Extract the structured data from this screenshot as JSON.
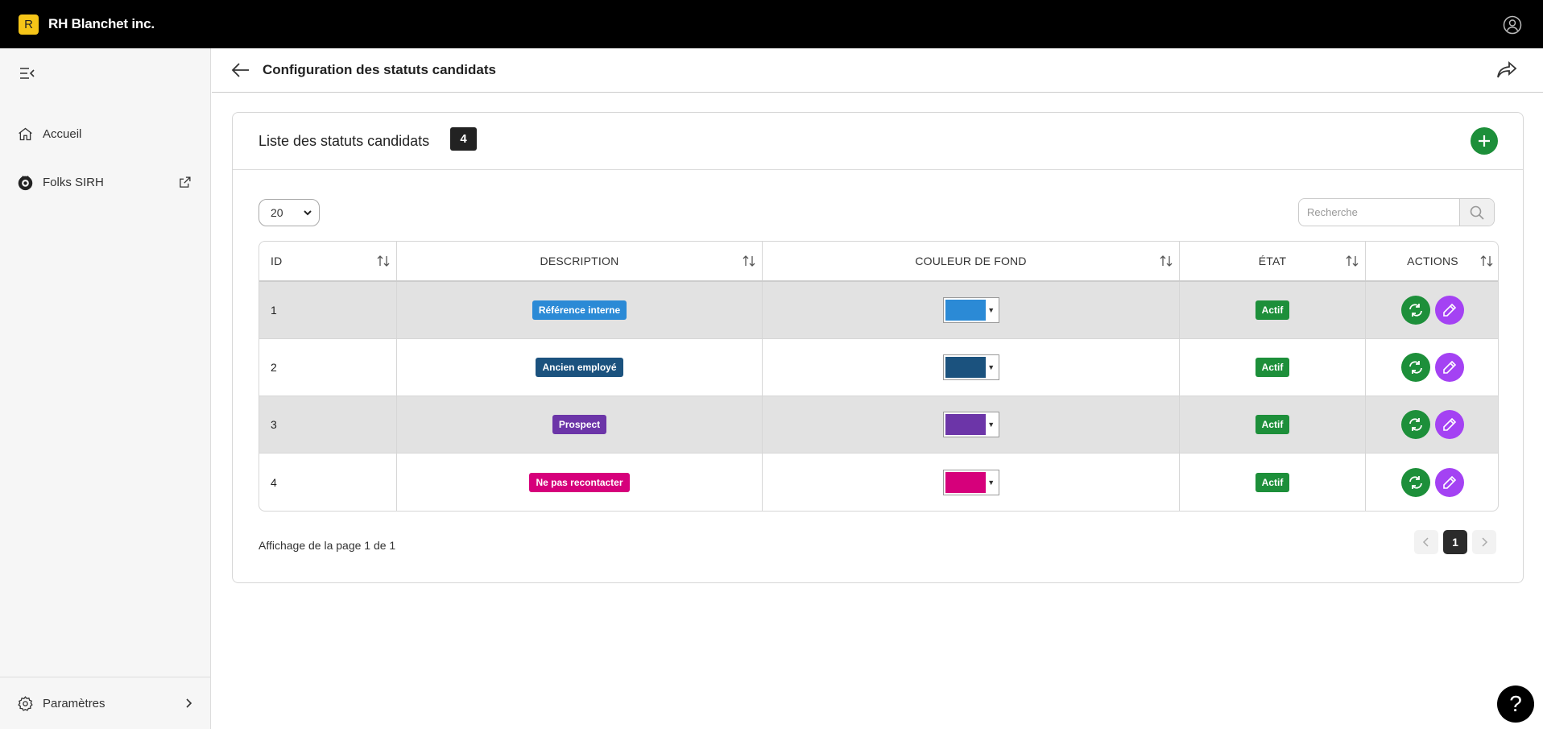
{
  "app": {
    "logo_letter": "R",
    "company": "RH Blanchet inc."
  },
  "sidebar": {
    "items": [
      {
        "label": "Accueil",
        "icon": "home-icon"
      },
      {
        "label": "Folks SIRH",
        "icon": "folks-icon"
      }
    ],
    "settings_label": "Paramètres"
  },
  "header": {
    "title": "Configuration des statuts candidats"
  },
  "card": {
    "title": "Liste des statuts candidats",
    "count": "4"
  },
  "controls": {
    "page_size": "20",
    "search_placeholder": "Recherche"
  },
  "table": {
    "columns": [
      "ID",
      "DESCRIPTION",
      "COULEUR DE FOND",
      "ÉTAT",
      "ACTIONS"
    ],
    "rows": [
      {
        "id": "1",
        "description": "Référence interne",
        "color": "#2b8ad6",
        "state": "Actif"
      },
      {
        "id": "2",
        "description": "Ancien employé",
        "color": "#1b527e",
        "state": "Actif"
      },
      {
        "id": "3",
        "description": "Prospect",
        "color": "#6c35a8",
        "state": "Actif"
      },
      {
        "id": "4",
        "description": "Ne pas recontacter",
        "color": "#d6007b",
        "state": "Actif"
      }
    ]
  },
  "footer": {
    "page_info": "Affichage de la page 1 de 1",
    "current_page": "1"
  },
  "help": {
    "label": "?"
  },
  "colors": {
    "accent_green": "#1d8f3a",
    "accent_purple": "#a442f3",
    "logo_yellow": "#f5c518"
  }
}
